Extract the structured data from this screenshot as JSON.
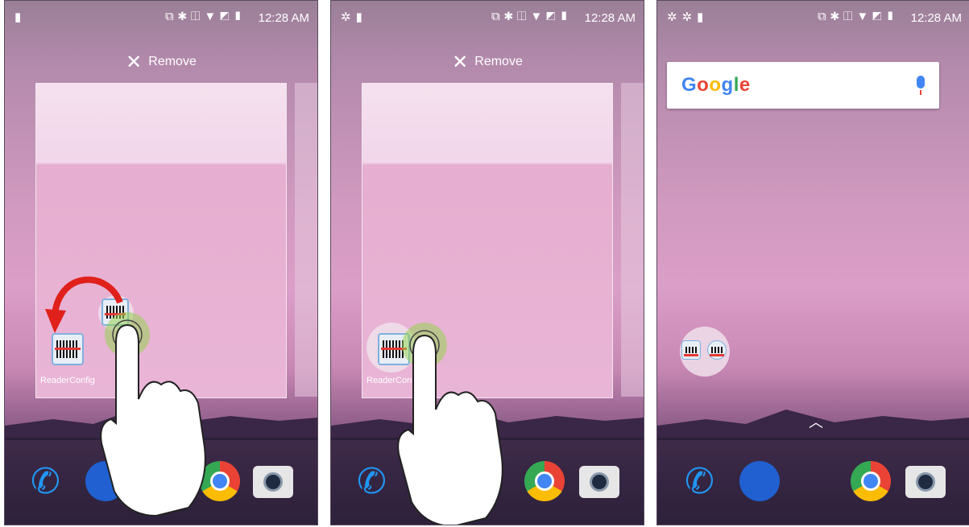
{
  "status_bar": {
    "time": "12:28 AM"
  },
  "remove_bar": {
    "label": "Remove",
    "icon": "close-icon"
  },
  "app": {
    "label": "ReaderConfig",
    "label_truncated": "ReaderCon"
  },
  "search": {
    "logo_text": "Google"
  },
  "dock": {
    "icons": [
      "phone-icon",
      "messages-icon",
      "chrome-icon",
      "camera-icon"
    ]
  },
  "colors": {
    "arrow": "#e0201a",
    "google_blue": "#4285f4",
    "google_red": "#ea4335",
    "google_yellow": "#fbbc05",
    "google_green": "#34a853"
  }
}
